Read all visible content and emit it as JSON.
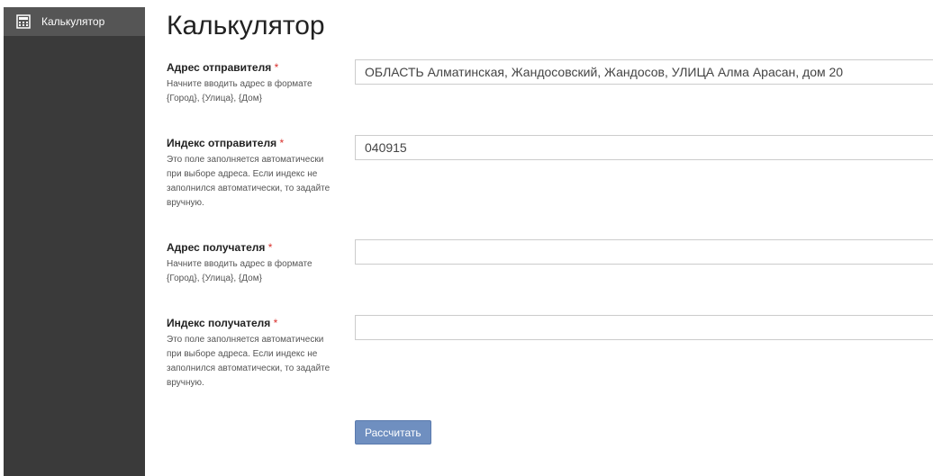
{
  "sidebar": {
    "items": [
      {
        "label": "Калькулятор",
        "icon": "calculator-icon"
      }
    ]
  },
  "page": {
    "title": "Калькулятор"
  },
  "form": {
    "sender_address": {
      "label": "Адрес отправителя",
      "required_mark": "*",
      "help": "Начните вводить адрес в формате {Город}, {Улица}, {Дом}",
      "value": "ОБЛАСТЬ Алматинская, Жандосовский, Жандосов, УЛИЦА Алма Арасан, дом 20"
    },
    "sender_index": {
      "label": "Индекс отправителя",
      "required_mark": "*",
      "help": "Это поле заполняется автоматически при выборе адреса. Если индекс не заполнился автоматически, то задайте вручную.",
      "value": "040915"
    },
    "recipient_address": {
      "label": "Адрес получателя",
      "required_mark": "*",
      "help": "Начните вводить адрес в формате {Город}, {Улица}, {Дом}",
      "value": ""
    },
    "recipient_index": {
      "label": "Индекс получателя",
      "required_mark": "*",
      "help": "Это поле заполняется автоматически при выборе адреса. Если индекс не заполнился автоматически, то задайте вручную.",
      "value": ""
    },
    "submit_label": "Рассчитать"
  },
  "colors": {
    "sidebar_bg": "#3a3a3a",
    "sidebar_active_bg": "#555555",
    "required": "#d9302c",
    "button_bg": "#6f8fc0"
  }
}
